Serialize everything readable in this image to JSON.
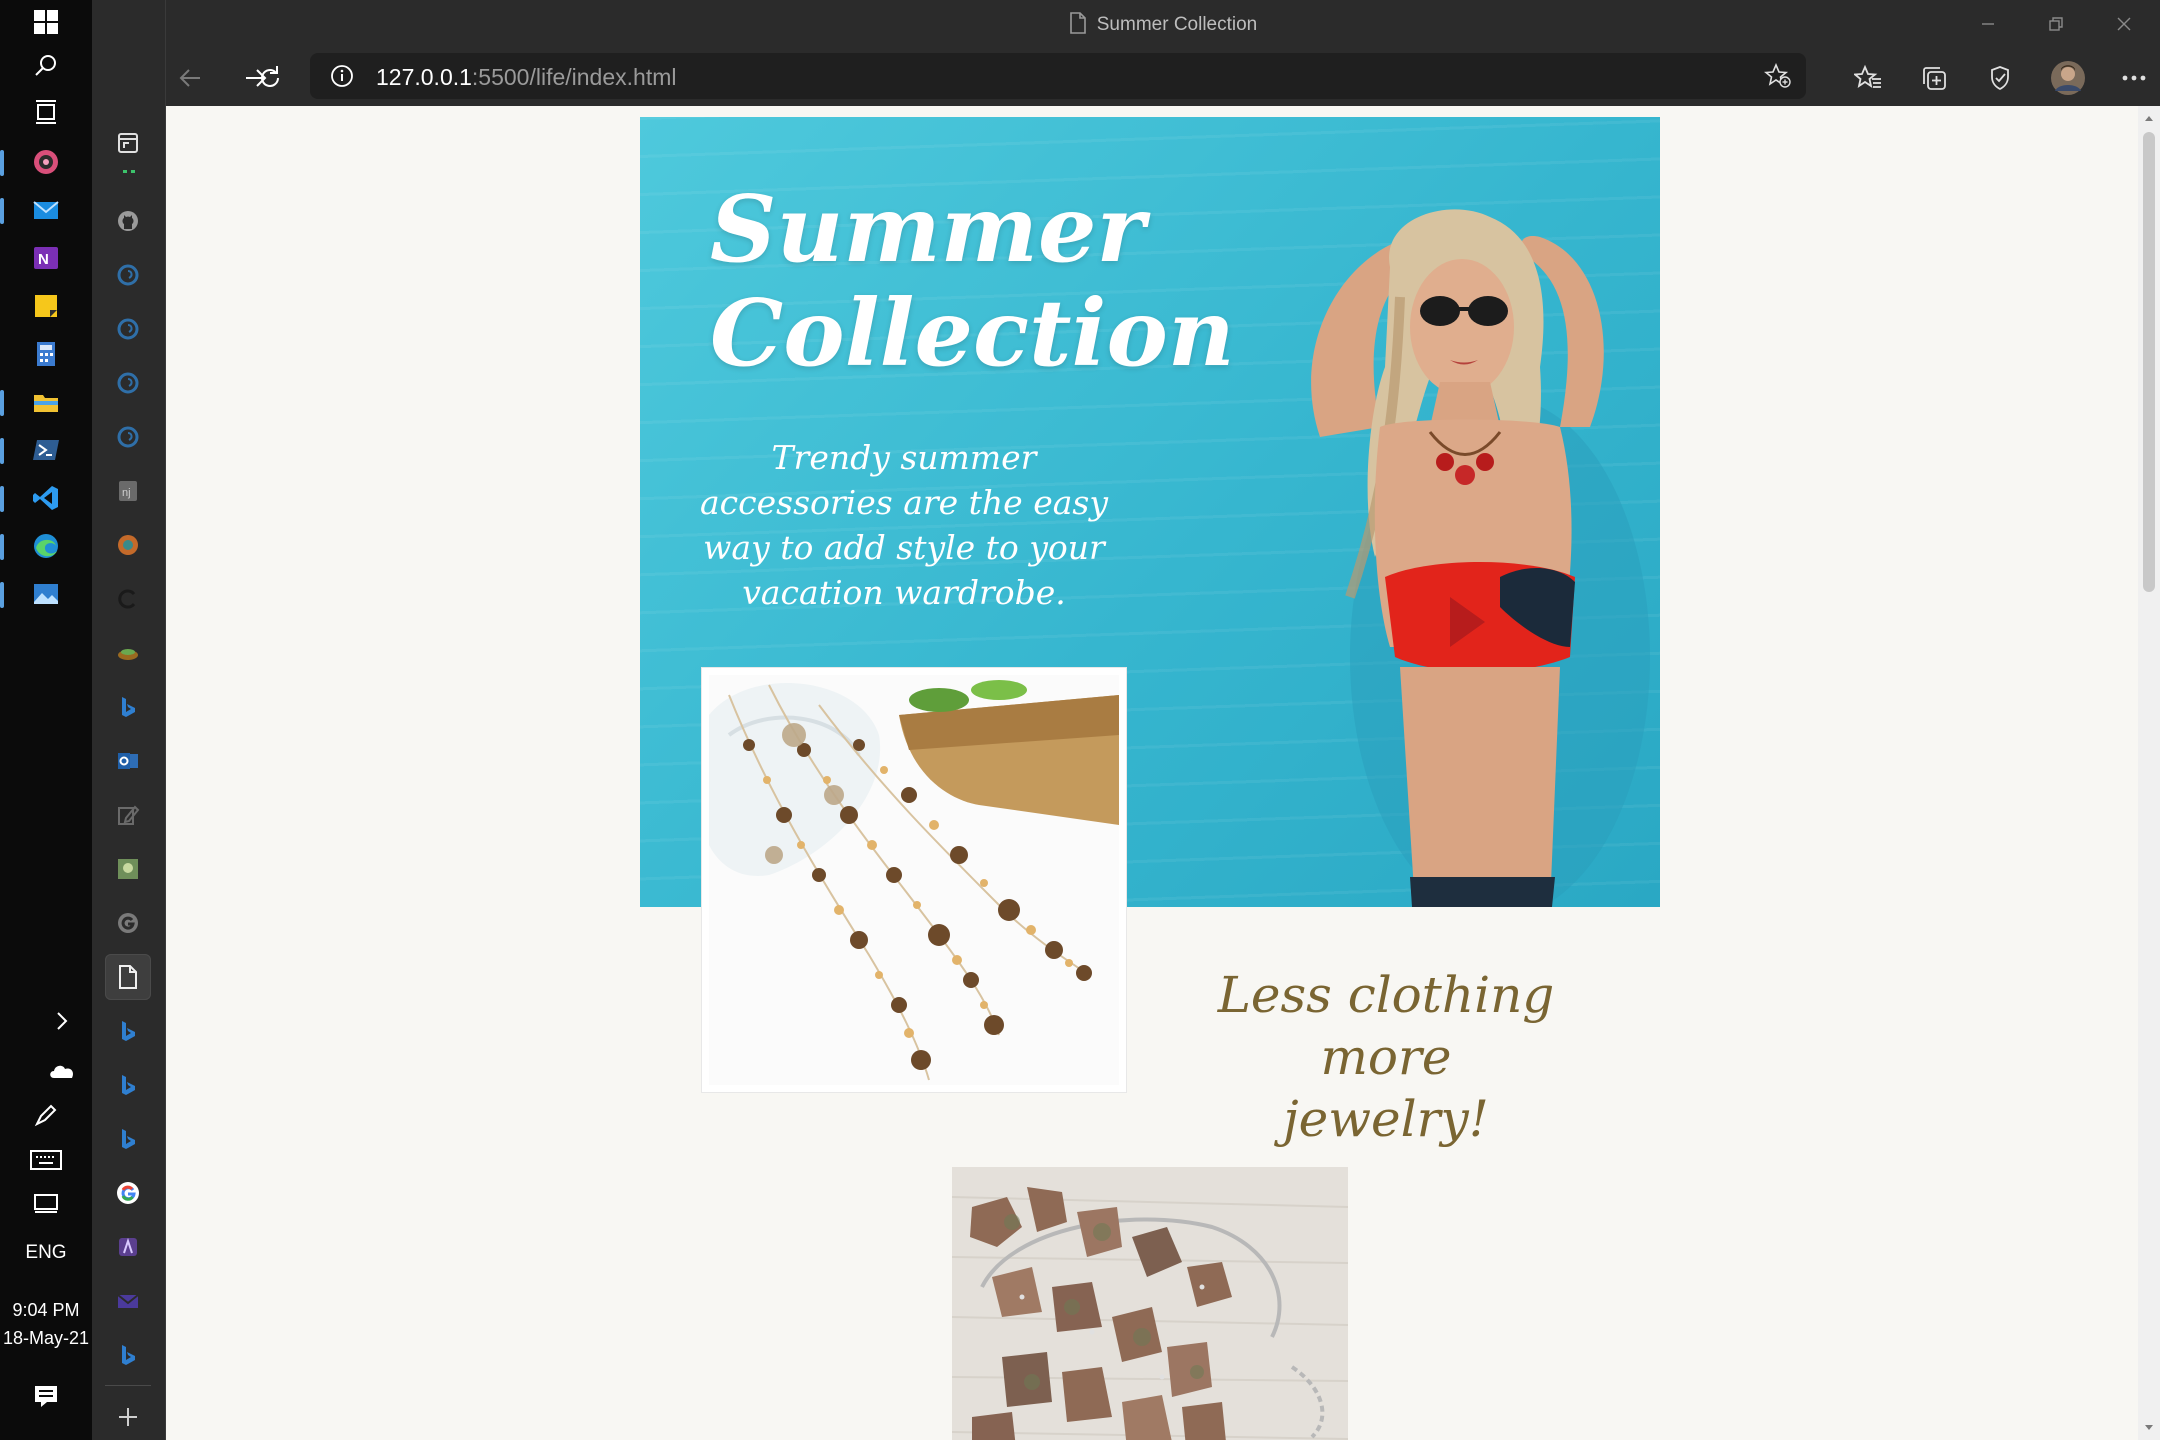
{
  "taskbar": {
    "language": "ENG",
    "time": "9:04 PM",
    "date": "18-May-21",
    "icons": [
      "windows-start-icon",
      "search-icon",
      "task-view-icon",
      "groove-music-icon",
      "mail-icon",
      "onenote-icon",
      "sticky-notes-icon",
      "calculator-icon",
      "file-explorer-icon",
      "powershell-icon",
      "vscode-icon",
      "edge-icon",
      "photos-icon"
    ]
  },
  "browser": {
    "window_title": "Summer Collection",
    "address": {
      "host": "127.0.0.1",
      "rest": ":5500/life/index.html"
    },
    "tab_icons": [
      "tab-actions-icon",
      "github-icon",
      "edge-tab-icon",
      "edge-tab-icon",
      "edge-tab-icon",
      "edge-tab-icon",
      "nodejs-icon",
      "tab-icon",
      "loading-icon",
      "tab-icon",
      "bing-icon",
      "outlook-icon",
      "edit-icon",
      "tab-icon",
      "google-icon",
      "page-icon",
      "bing-icon",
      "bing-icon",
      "bing-icon",
      "google-icon",
      "tab-icon",
      "tab-icon",
      "bing-icon"
    ]
  },
  "page": {
    "hero_title_line1": "Summer",
    "hero_title_line2": "Collection",
    "hero_subtitle": "Trendy summer accessories are the easy way to add style to your vacation wardrobe.",
    "tagline_line1": "Less clothing more",
    "tagline_line2": "jewelry!"
  },
  "colors": {
    "hero_bg": "#36b6cf",
    "tagline": "#7a6532",
    "page_bg": "#f8f7f3",
    "chrome": "#2b2b2b"
  }
}
